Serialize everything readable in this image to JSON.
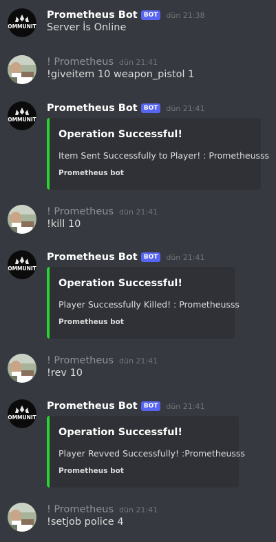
{
  "messages": [
    {
      "author": "Prometheus Bot",
      "bot_tag": "BOT",
      "time": "dün 21:38",
      "text": "Server İs Online",
      "avatar_icon": "bot-crown-logo",
      "avatar_text": "OMMUNIT"
    },
    {
      "author": "! Prometheus",
      "time": "dün 21:41",
      "text": "!giveitem 10 weapon_pistol 1",
      "avatar_icon": "user-photo"
    },
    {
      "author": "Prometheus Bot",
      "bot_tag": "BOT",
      "time": "dün 21:41",
      "avatar_icon": "bot-crown-logo",
      "avatar_text": "OMMUNIT",
      "embed": {
        "title": "Operation Successful!",
        "description": "Item Sent Successfully to Player! : Prometheusss",
        "footer": "Prometheus bot",
        "color": "#27d630"
      }
    },
    {
      "author": "! Prometheus",
      "time": "dün 21:41",
      "text": "!kill 10",
      "avatar_icon": "user-photo"
    },
    {
      "author": "Prometheus Bot",
      "bot_tag": "BOT",
      "time": "dün 21:41",
      "avatar_icon": "bot-crown-logo",
      "avatar_text": "OMMUNIT",
      "embed": {
        "title": "Operation Successful!",
        "description": "Player Successfully Killed! : Prometheusss",
        "footer": "Prometheus bot",
        "color": "#27d630"
      }
    },
    {
      "author": "! Prometheus",
      "time": "dün 21:41",
      "text": "!rev 10",
      "avatar_icon": "user-photo"
    },
    {
      "author": "Prometheus Bot",
      "bot_tag": "BOT",
      "time": "dün 21:41",
      "avatar_icon": "bot-crown-logo",
      "avatar_text": "OMMUNIT",
      "embed": {
        "title": "Operation Successful!",
        "description": "Player Revved Successfully! :Prometheusss",
        "footer": "Prometheus bot",
        "color": "#27d630"
      }
    },
    {
      "author": "! Prometheus",
      "time": "dün 21:41",
      "text": "!setjob police 4",
      "avatar_icon": "user-photo"
    }
  ],
  "colors": {
    "background": "#36393f",
    "embed_background": "#2f3136",
    "embed_accent": "#27d630",
    "bot_tag": "#5865f2",
    "text": "#dcddde",
    "username_muted": "#8e9297",
    "timestamp": "#72767d"
  }
}
